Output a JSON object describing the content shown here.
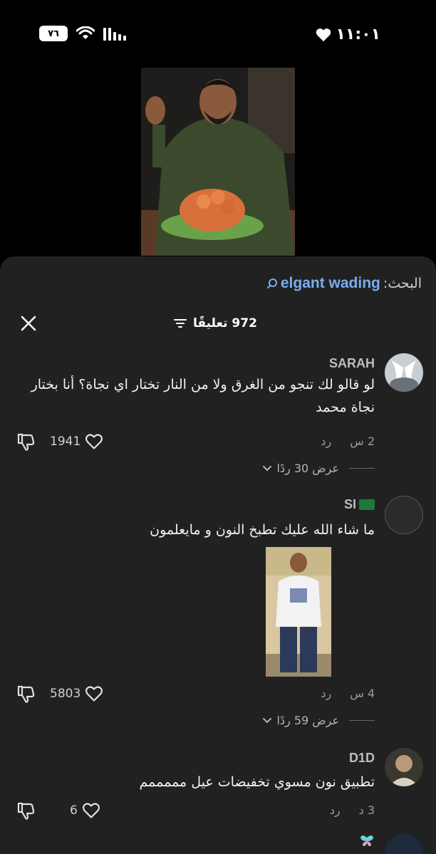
{
  "status_bar": {
    "battery": "٧٦",
    "time": "١١:٠١"
  },
  "search": {
    "label": "البحث:",
    "term": "elgant wading"
  },
  "header": {
    "count_label": "972 تعليقًا"
  },
  "comments": [
    {
      "username": "SARAH",
      "text": "لو قالو لك تنجو من الغرق ولا من النار تختار اي نجاة؟ أنا بختار نجاة محمد",
      "time": "2 س",
      "reply": "رد",
      "likes": "1941",
      "view_replies": "عرض 30 ردًا"
    },
    {
      "username": "SI",
      "text": "ما شاء الله عليك تطبخ النون و مايعلمون",
      "time": "4 س",
      "reply": "رد",
      "likes": "5803",
      "view_replies": "عرض 59 ردًا"
    },
    {
      "username": "D1D",
      "text": "تطبيق نون مسوي تخفيضات عيل مممممم",
      "time": "3 د",
      "reply": "رد",
      "likes": "6"
    }
  ],
  "colors": {
    "sheet_bg": "#212121",
    "accent_link": "#78aef0"
  }
}
